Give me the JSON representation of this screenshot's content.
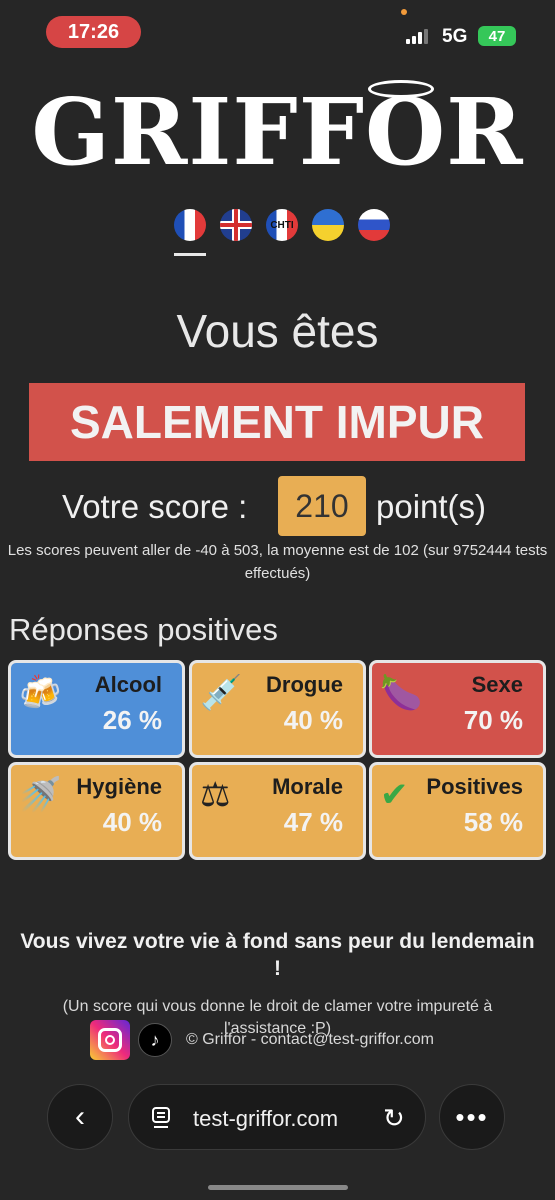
{
  "status_bar": {
    "time": "17:26",
    "network": "5G",
    "battery": "47"
  },
  "logo": {
    "text": "GRIFFOR"
  },
  "languages": [
    {
      "code": "fr",
      "label": ""
    },
    {
      "code": "en",
      "label": ""
    },
    {
      "code": "chti",
      "label": "CHTI"
    },
    {
      "code": "ua",
      "label": ""
    },
    {
      "code": "ru",
      "label": ""
    }
  ],
  "result": {
    "heading": "Vous êtes",
    "verdict": "SALEMENT IMPUR",
    "score_label": "Votre score :",
    "score_value": "210",
    "score_unit": "point(s)",
    "info": "Les scores peuvent aller de -40 à 503, la moyenne est de 102 (sur 9752444 tests effectués)"
  },
  "positives": {
    "title": "Réponses positives",
    "cards": [
      {
        "title": "Alcool",
        "value": "26 %",
        "icon": "beer-mugs-icon",
        "glyph": "🍻",
        "color": "#4f8fd8"
      },
      {
        "title": "Drogue",
        "value": "40 %",
        "icon": "syringe-icon",
        "glyph": "💉",
        "color": "#e8ae54"
      },
      {
        "title": "Sexe",
        "value": "70 %",
        "icon": "eggplant-icon",
        "glyph": "🍆",
        "color": "#d2524b"
      },
      {
        "title": "Hygiène",
        "value": "40 %",
        "icon": "shower-icon",
        "glyph": "🚿",
        "color": "#e8ae54"
      },
      {
        "title": "Morale",
        "value": "47 %",
        "icon": "scales-icon",
        "glyph": "⚖",
        "color": "#e8ae54"
      },
      {
        "title": "Positives",
        "value": "58 %",
        "icon": "check-mark-icon",
        "glyph": "✔",
        "color": "#e8ae54"
      }
    ]
  },
  "conclusion": {
    "headline": "Vous vivez votre vie à fond sans peur du lendemain !",
    "note": "(Un score qui vous donne le droit de clamer votre impureté à l'assistance :P)"
  },
  "footer": {
    "copyright": "© Griffor - contact@test-griffor.com"
  },
  "browser": {
    "url": "test-griffor.com"
  }
}
